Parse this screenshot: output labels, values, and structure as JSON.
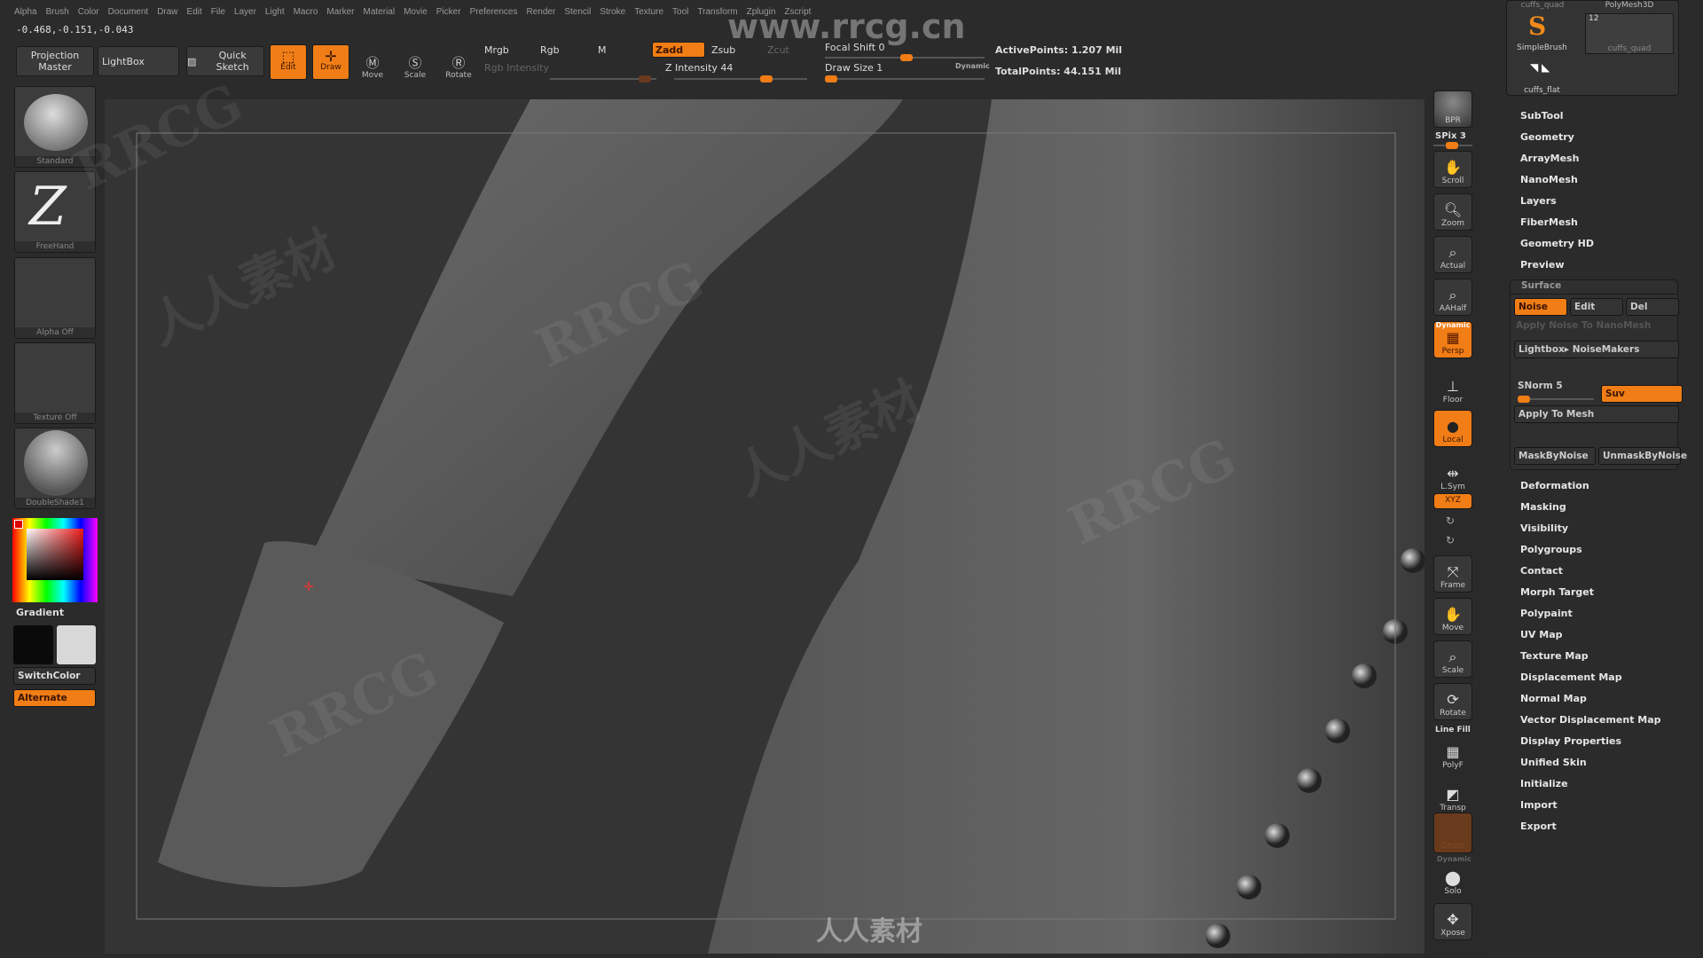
{
  "menu": [
    "Alpha",
    "Brush",
    "Color",
    "Document",
    "Draw",
    "Edit",
    "File",
    "Layer",
    "Light",
    "Macro",
    "Marker",
    "Material",
    "Movie",
    "Picker",
    "Preferences",
    "Render",
    "Stencil",
    "Stroke",
    "Texture",
    "Tool",
    "Transform",
    "Zplugin",
    "Zscript"
  ],
  "coords": "-0.468,-0.151,-0.043",
  "toolbar": {
    "projection_master": "Projection Master",
    "lightbox": "LightBox",
    "quick_sketch": "Quick Sketch",
    "edit": "Edit",
    "draw": "Draw",
    "move": "Move",
    "scale": "Scale",
    "rotate": "Rotate",
    "mrgb": "Mrgb",
    "rgb": "Rgb",
    "m": "M",
    "rgb_intensity": "Rgb Intensity",
    "zadd": "Zadd",
    "zsub": "Zsub",
    "zcut": "Zcut",
    "z_intensity": "Z Intensity 44",
    "z_intensity_value": 44,
    "focal_shift": "Focal Shift 0",
    "draw_size": "Draw Size 1",
    "dynamic": "Dynamic",
    "active_points": "ActivePoints: 1.207 Mil",
    "total_points": "TotalPoints: 44.151 Mil"
  },
  "left": {
    "brush": "Standard",
    "stroke": "FreeHand",
    "alpha": "Alpha Off",
    "texture": "Texture Off",
    "material": "DoubleShade1",
    "gradient": "Gradient",
    "switch_color": "SwitchColor",
    "alternate": "Alternate",
    "main_color": "#0a0a0a",
    "secondary_color": "#d8d8d8"
  },
  "shelf": {
    "bpr": "BPR",
    "spix": "SPix 3",
    "scroll": "Scroll",
    "zoom": "Zoom",
    "actual": "Actual",
    "aahalf": "AAHalf",
    "dynamic": "Dynamic",
    "persp": "Persp",
    "floor": "Floor",
    "local": "Local",
    "lsym": "L.Sym",
    "xyz": "XYZ",
    "frame": "Frame",
    "move": "Move",
    "scale": "Scale",
    "rotate": "Rotate",
    "line_fill": "Line Fill",
    "polyf": "PolyF",
    "transp": "Transp",
    "ghost": "Ghost",
    "dynamic2": "Dynamic",
    "solo": "Solo",
    "xpose": "Xpose"
  },
  "tool": {
    "current_top": "cuffs_quad",
    "type": "PolyMesh3D",
    "simple_brush": "SimpleBrush",
    "thumb_count": "12",
    "thumb_name": "cuffs_quad",
    "flat": "cuffs_flat"
  },
  "palette_top": [
    "SubTool",
    "Geometry",
    "ArrayMesh",
    "NanoMesh",
    "Layers",
    "FiberMesh",
    "Geometry HD",
    "Preview"
  ],
  "surface": {
    "title": "Surface",
    "noise": "Noise",
    "edit": "Edit",
    "del": "Del",
    "apply_nano": "Apply Noise To NanoMesh",
    "lightbox_noise": "Lightbox▸ NoiseMakers",
    "snorm": "SNorm 5",
    "snorm_value": 5,
    "suv": "Suv",
    "apply_mesh": "Apply To Mesh",
    "mask": "MaskByNoise",
    "unmask": "UnmaskByNoise"
  },
  "palette_bottom": [
    "Deformation",
    "Masking",
    "Visibility",
    "Polygroups",
    "Contact",
    "Morph Target",
    "Polypaint",
    "UV Map",
    "Texture Map",
    "Displacement Map",
    "Normal Map",
    "Vector Displacement Map",
    "Display Properties",
    "Unified Skin",
    "Initialize",
    "Import",
    "Export"
  ],
  "watermarks": {
    "url": "www.rrcg.cn",
    "brand": "RRCG",
    "cn": "人人素材"
  },
  "accent": "#f07d16"
}
